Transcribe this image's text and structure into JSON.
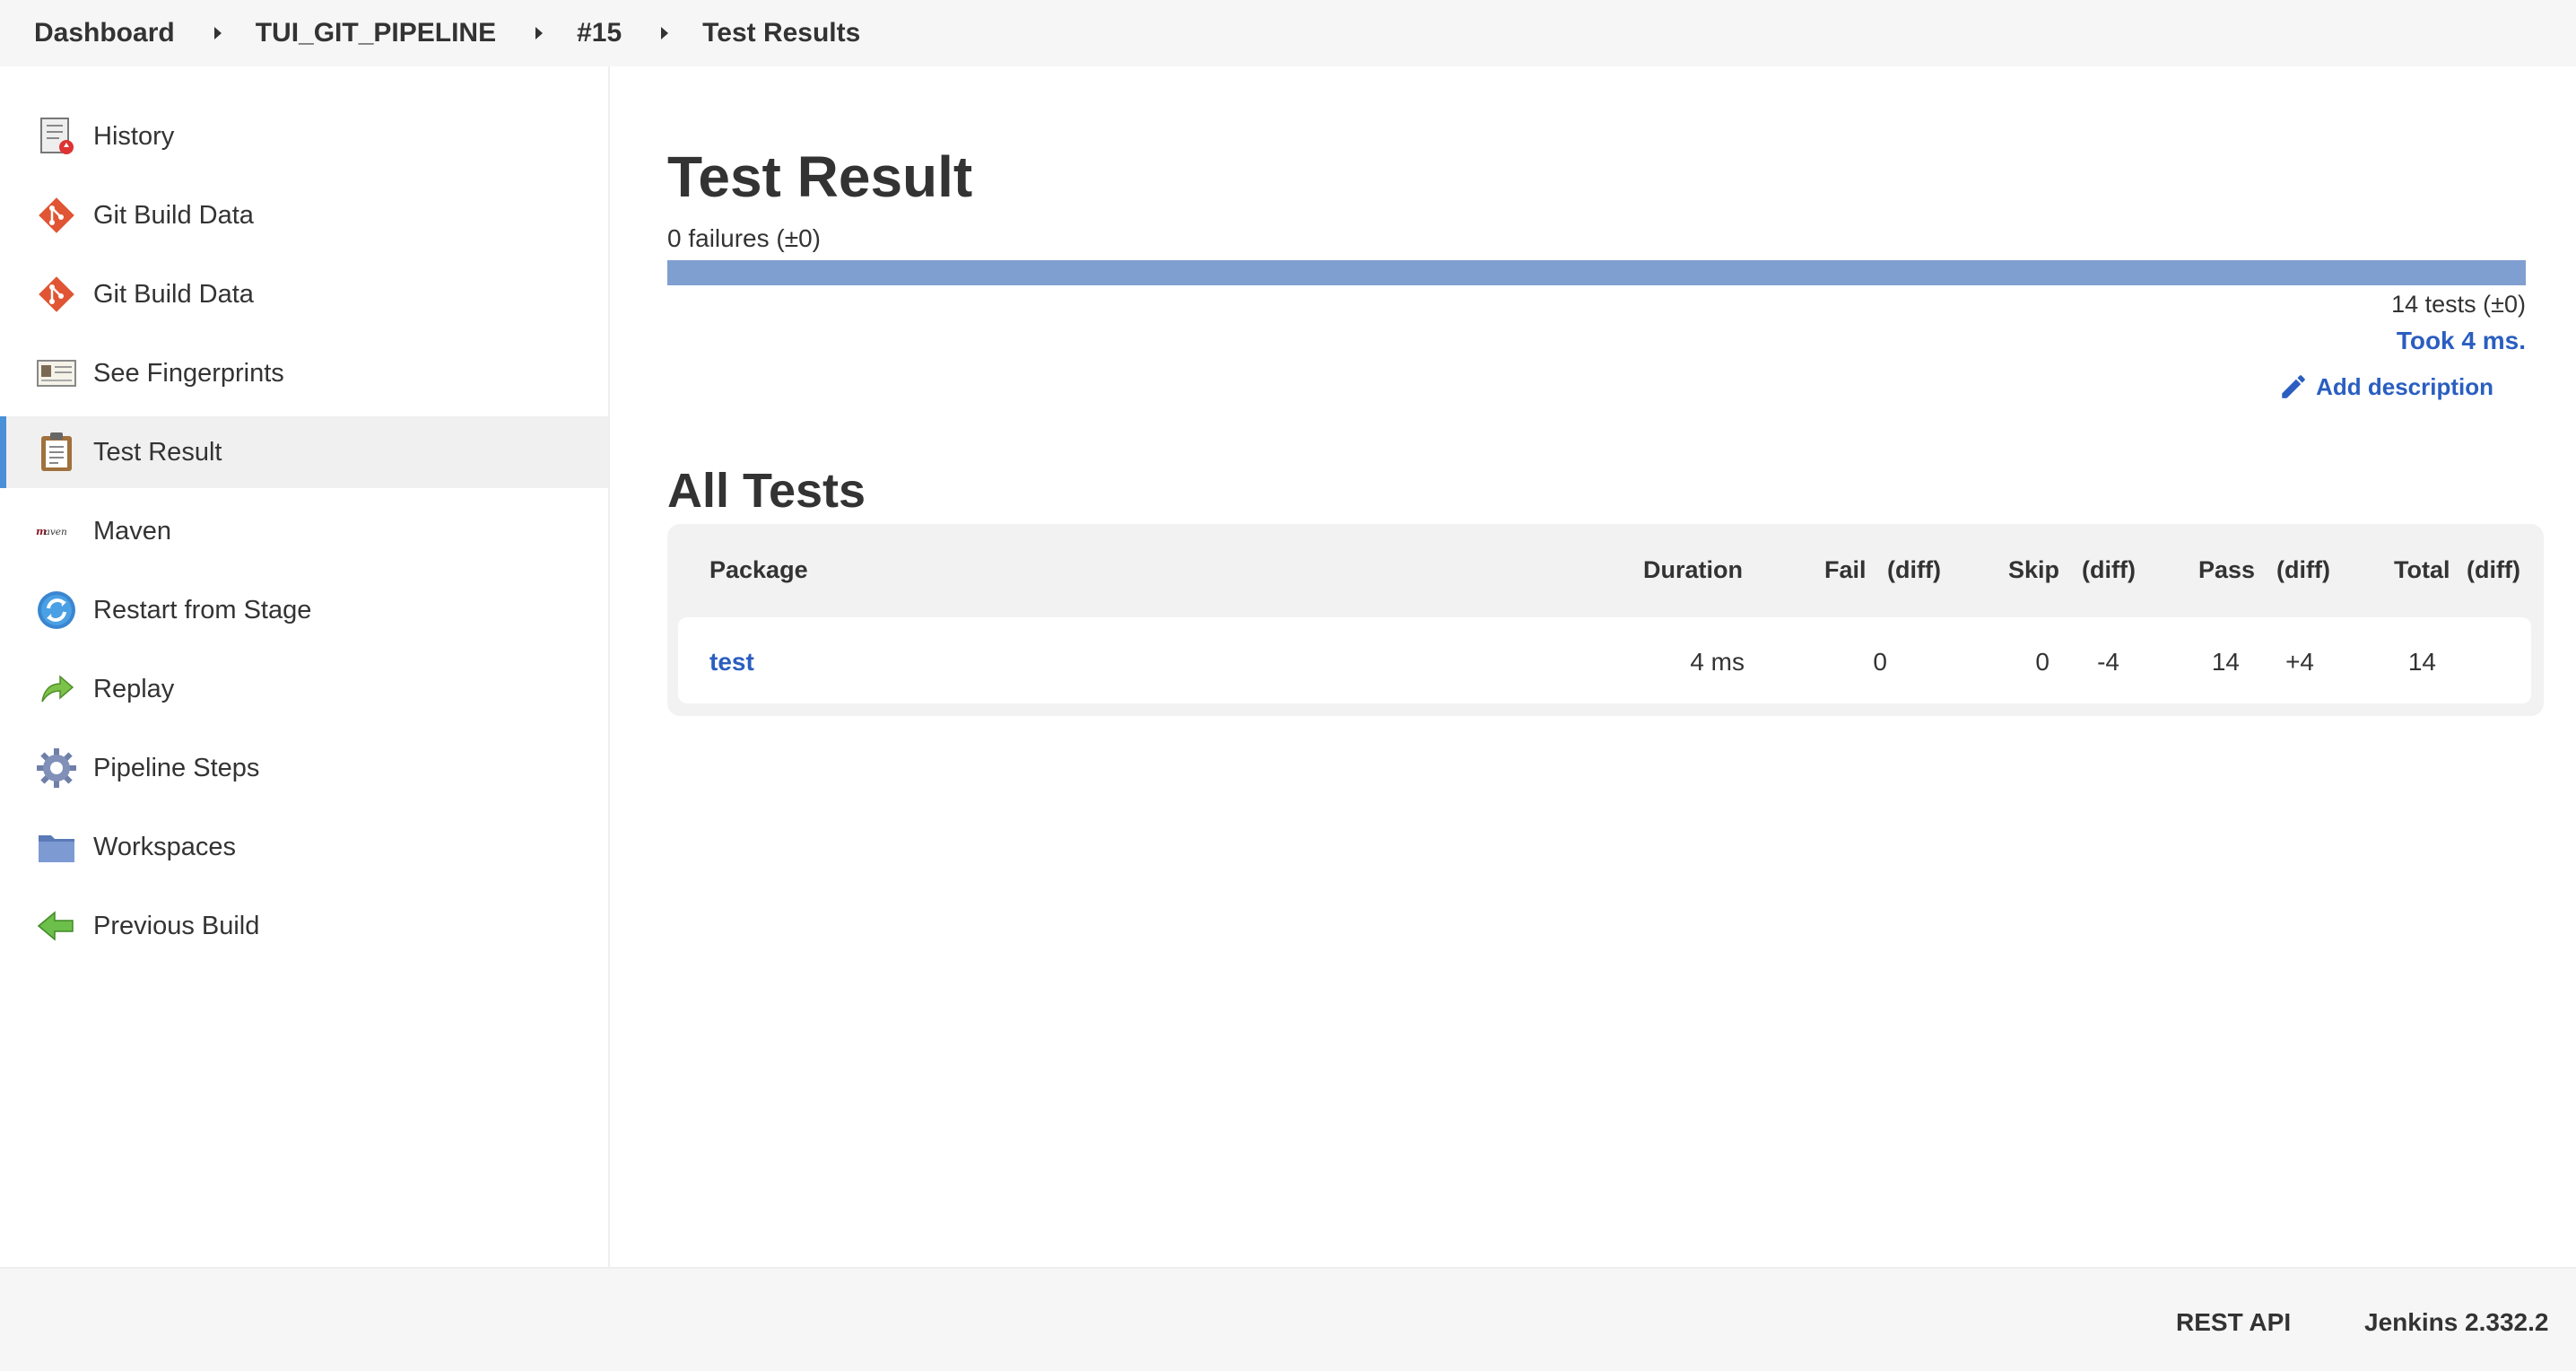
{
  "breadcrumb": {
    "items": [
      "Dashboard",
      "TUI_GIT_PIPELINE",
      "#15",
      "Test Results"
    ]
  },
  "sidebar": {
    "items": [
      {
        "label": "History",
        "icon": "history-icon"
      },
      {
        "label": "Git Build Data",
        "icon": "git-icon"
      },
      {
        "label": "Git Build Data",
        "icon": "git-icon"
      },
      {
        "label": "See Fingerprints",
        "icon": "fingerprint-card-icon"
      },
      {
        "label": "Test Result",
        "icon": "clipboard-icon",
        "active": true
      },
      {
        "label": "Maven",
        "icon": "maven-logo-icon"
      },
      {
        "label": "Restart from Stage",
        "icon": "restart-icon"
      },
      {
        "label": "Replay",
        "icon": "replay-arrow-icon"
      },
      {
        "label": "Pipeline Steps",
        "icon": "gear-icon"
      },
      {
        "label": "Workspaces",
        "icon": "folder-icon"
      },
      {
        "label": "Previous Build",
        "icon": "back-arrow-icon"
      }
    ]
  },
  "main": {
    "title": "Test Result",
    "failures": "0 failures (±0)",
    "pass_fraction": 1.0,
    "tests_count": "14 tests (±0)",
    "took": "Took 4 ms.",
    "add_description": "Add description",
    "all_tests_title": "All Tests",
    "table": {
      "headers": {
        "package": "Package",
        "duration": "Duration",
        "fail": "Fail",
        "fail_diff": "(diff)",
        "skip": "Skip",
        "skip_diff": "(diff)",
        "pass": "Pass",
        "pass_diff": "(diff)",
        "total": "Total",
        "total_diff": "(diff)"
      },
      "rows": [
        {
          "package": "test",
          "duration": "4 ms",
          "fail": "0",
          "fail_diff": "",
          "skip": "0",
          "skip_diff": "-4",
          "pass": "14",
          "pass_diff": "+4",
          "total": "14",
          "total_diff": ""
        }
      ]
    }
  },
  "footer": {
    "rest_api": "REST API",
    "version": "Jenkins 2.332.2"
  },
  "colors": {
    "link": "#2a5ec0",
    "progress_pass": "#7f9fd0",
    "active_marker": "#4a90d9"
  }
}
